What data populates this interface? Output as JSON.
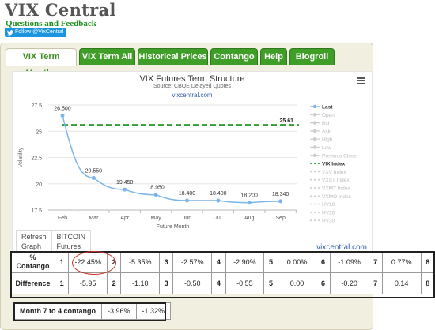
{
  "site": {
    "title": "VIX Central",
    "feedback": "Questions and Feedback",
    "follow": "Follow @VixCentral"
  },
  "tabs": [
    {
      "label": "VIX Term Months",
      "active": true
    },
    {
      "label": "VIX Term All",
      "active": false
    },
    {
      "label": "Historical Prices",
      "active": false
    },
    {
      "label": "Contango",
      "active": false
    },
    {
      "label": "Help",
      "active": false
    },
    {
      "label": "Blogroll",
      "active": false
    }
  ],
  "chart": {
    "title": "VIX Futures Term Structure",
    "subtitle": "Source: CBOE Delayed Quotes",
    "credit_top": "vixcentral.com",
    "credit_bottom": "vixcentral.com",
    "menu_icon": "hamburger-menu-icon"
  },
  "chart_data": {
    "type": "line",
    "title": "VIX Futures Term Structure",
    "subtitle": "Source: CBOE Delayed Quotes",
    "xlabel": "Future Month",
    "ylabel": "Volatility",
    "categories": [
      "Feb",
      "Mar",
      "Apr",
      "May",
      "Jun",
      "Jul",
      "Aug",
      "Sep"
    ],
    "ylim": [
      17.5,
      27.5
    ],
    "yticks": [
      17.5,
      20,
      22.5,
      25,
      27.5
    ],
    "grid": true,
    "legend_position": "right",
    "series": [
      {
        "name": "Last",
        "values": [
          26.5,
          20.55,
          19.45,
          18.95,
          18.4,
          18.4,
          18.2,
          18.34
        ],
        "color": "#7cb5ec"
      },
      {
        "name": "VIX Index",
        "values": [
          25.61,
          25.61,
          25.61,
          25.61,
          25.61,
          25.61,
          25.61,
          25.61
        ],
        "color": "#2f9e2f"
      }
    ],
    "point_labels": [
      "26.500",
      "20.550",
      "19.450",
      "18.950",
      "18.400",
      "18.400",
      "18.200",
      "18.340"
    ],
    "vix_label": "25.61",
    "legend": [
      {
        "label": "Last",
        "active": true,
        "kind": "line-dot"
      },
      {
        "label": "Open",
        "active": false,
        "kind": "line-dot"
      },
      {
        "label": "Bid",
        "active": false,
        "kind": "line-dot"
      },
      {
        "label": "Ask",
        "active": false,
        "kind": "line-dot"
      },
      {
        "label": "High",
        "active": false,
        "kind": "line-dot"
      },
      {
        "label": "Low",
        "active": false,
        "kind": "line-dot"
      },
      {
        "label": "Previous Close",
        "active": false,
        "kind": "line-dot"
      },
      {
        "label": "VIX Index",
        "active": true,
        "kind": "dash"
      },
      {
        "label": "VXV Index",
        "active": false,
        "kind": "dash"
      },
      {
        "label": "VXST Index",
        "active": false,
        "kind": "dash"
      },
      {
        "label": "VXMT Index",
        "active": false,
        "kind": "dash"
      },
      {
        "label": "VXMO Index",
        "active": false,
        "kind": "dash"
      },
      {
        "label": "HV10",
        "active": false,
        "kind": "dash"
      },
      {
        "label": "HV20",
        "active": false,
        "kind": "dash"
      },
      {
        "label": "HV30",
        "active": false,
        "kind": "dash"
      }
    ]
  },
  "refresh": {
    "refresh_label": "Refresh",
    "graph_label": "Graph",
    "bitcoin_label": "BITCOIN",
    "futures_label": "Futures"
  },
  "contango_table": {
    "row1_label_a": "%",
    "row1_label_b": "Contango",
    "row2_label": "Difference",
    "months": [
      "1",
      "2",
      "3",
      "4",
      "5",
      "6",
      "7",
      "8"
    ],
    "contango": [
      "-22.45%",
      "-5.35%",
      "-2.57%",
      "-2.90%",
      "0.00%",
      "-1.09%",
      "0.77%",
      ""
    ],
    "difference": [
      "-5.95",
      "-1.10",
      "-0.50",
      "-0.55",
      "0.00",
      "-0.20",
      "0.14",
      ""
    ]
  },
  "month7": {
    "label": "Month 7 to 4 contango",
    "v1": "-3.96%",
    "v2": "-1.32%"
  }
}
